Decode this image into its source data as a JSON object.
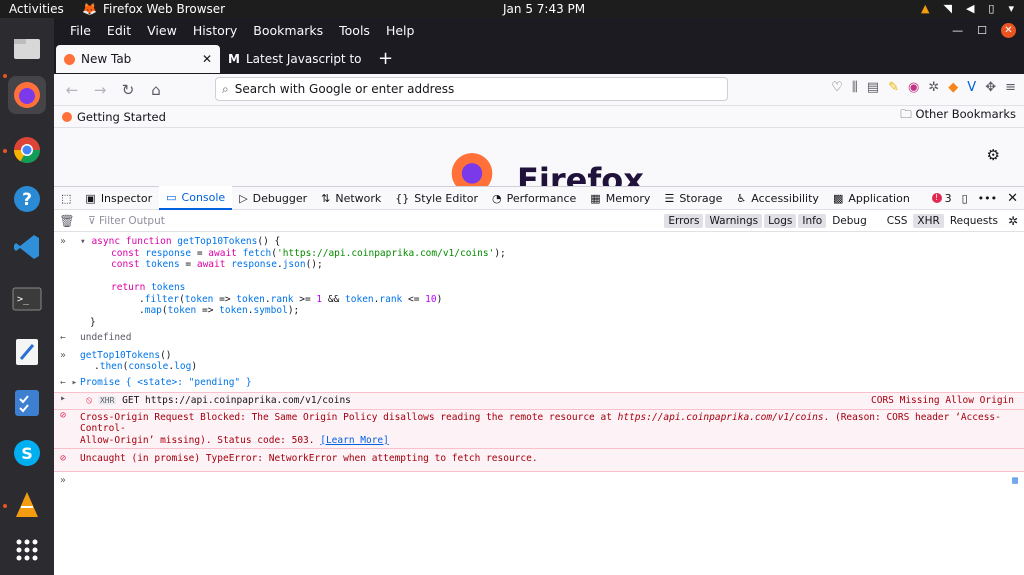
{
  "top": {
    "activities": "Activities",
    "app": "Firefox Web Browser",
    "clock": "Jan 5  7:43 PM"
  },
  "menu": [
    "File",
    "Edit",
    "View",
    "History",
    "Bookmarks",
    "Tools",
    "Help"
  ],
  "tabs": [
    {
      "label": "New Tab"
    },
    {
      "label": "Latest Javascript topics -"
    }
  ],
  "urlbar": {
    "placeholder": "Search with Google or enter address"
  },
  "bookmarks": {
    "first": "Getting Started",
    "other": "Other Bookmarks"
  },
  "page": {
    "logo_text": "Firefox"
  },
  "devtools": {
    "tabs": [
      "Inspector",
      "Console",
      "Debugger",
      "Network",
      "Style Editor",
      "Performance",
      "Memory",
      "Storage",
      "Accessibility",
      "Application"
    ],
    "error_count": "3",
    "filter_placeholder": "Filter Output",
    "filters": [
      "Errors",
      "Warnings",
      "Logs",
      "Info",
      "Debug",
      "CSS",
      "XHR",
      "Requests"
    ]
  },
  "console": {
    "undefined": "undefined",
    "promise": "Promise { <state>: \"pending\" }",
    "get_url": "GET https://api.coinpaprika.com/v1/coins",
    "cors_label": "CORS Missing Allow Origin",
    "xhr": "XHR",
    "error1_a": "Cross-Origin Request Blocked: The Same Origin Policy disallows reading the remote resource at ",
    "error1_url": "https://api.coinpaprika.com/v1/coins",
    "error1_b": ". (Reason: CORS header ‘Access-Control-",
    "error1_c": "Allow-Origin’ missing). Status code: 503. ",
    "learn_more": "[Learn More]",
    "error2": "Uncaught (in promise) TypeError: NetworkError when attempting to fetch resource."
  }
}
